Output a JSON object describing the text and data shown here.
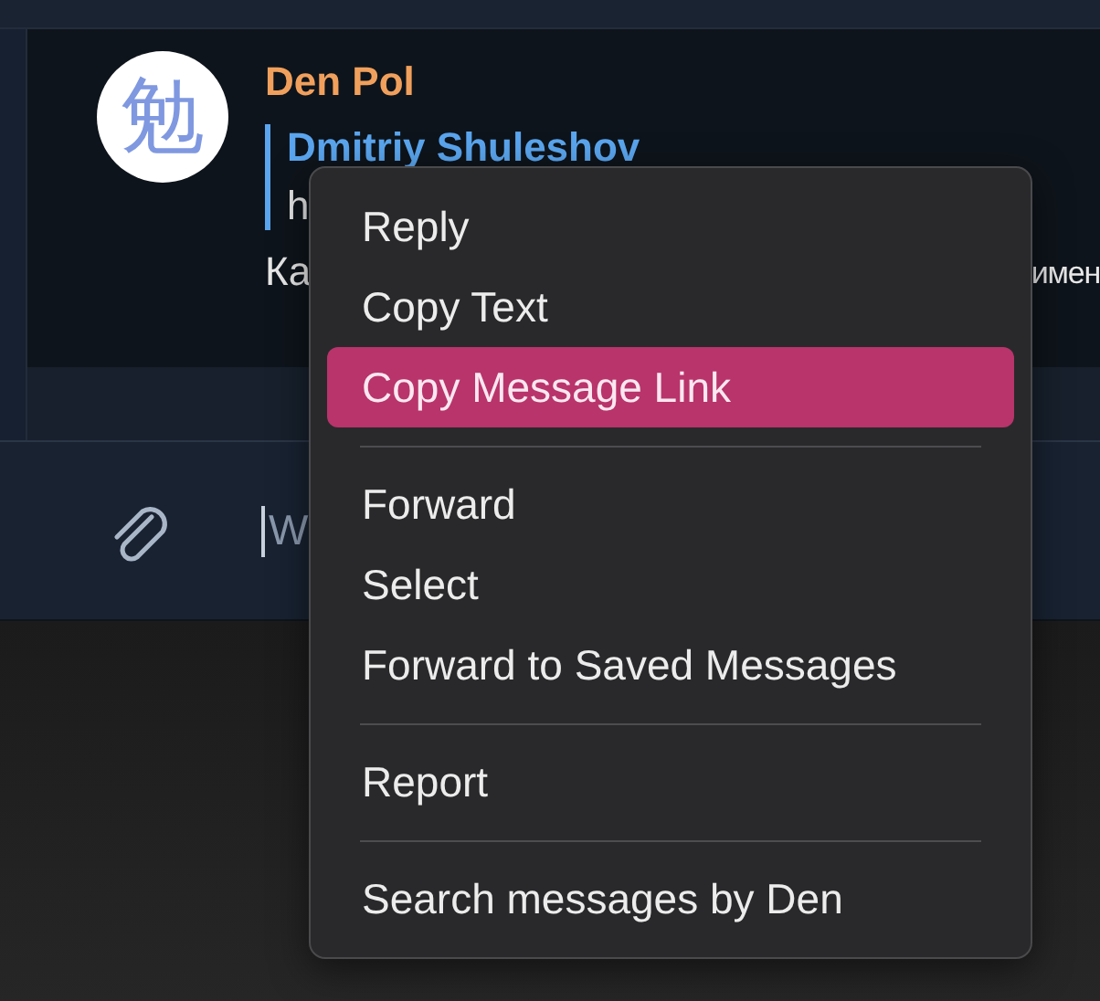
{
  "message": {
    "avatar_glyph": "勉",
    "author": "Den Pol",
    "reply": {
      "author": "Dmitriy Shuleshov",
      "text": "h"
    },
    "text_start": "Ка",
    "text_end": "имен"
  },
  "composer": {
    "placeholder": "W"
  },
  "context_menu": {
    "groups": [
      [
        {
          "label": "Reply",
          "selected": false
        },
        {
          "label": "Copy Text",
          "selected": false
        },
        {
          "label": "Copy Message Link",
          "selected": true
        }
      ],
      [
        {
          "label": "Forward",
          "selected": false
        },
        {
          "label": "Select",
          "selected": false
        },
        {
          "label": "Forward to Saved Messages",
          "selected": false
        }
      ],
      [
        {
          "label": "Report",
          "selected": false
        }
      ],
      [
        {
          "label": "Search messages by Den",
          "selected": false
        }
      ]
    ]
  }
}
